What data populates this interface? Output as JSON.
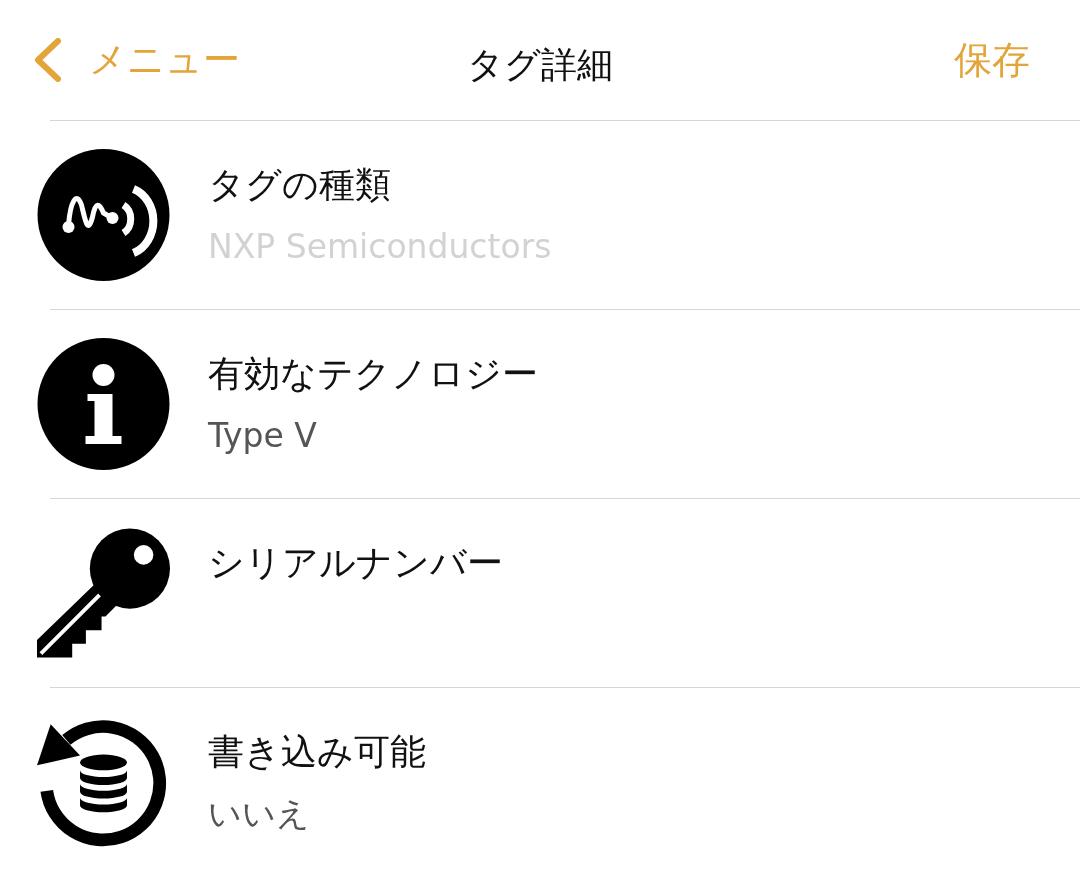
{
  "nav": {
    "back": "メニュー",
    "title": "タグ詳細",
    "action": "保存"
  },
  "rows": [
    {
      "title": "タグの種類",
      "value": "NXP Semiconductors",
      "faded": true
    },
    {
      "title": "有効なテクノロジー",
      "value": "Type V",
      "faded": false
    },
    {
      "title": "シリアルナンバー"
    },
    {
      "title": "書き込み可能",
      "value": "いいえ",
      "faded": false
    }
  ]
}
